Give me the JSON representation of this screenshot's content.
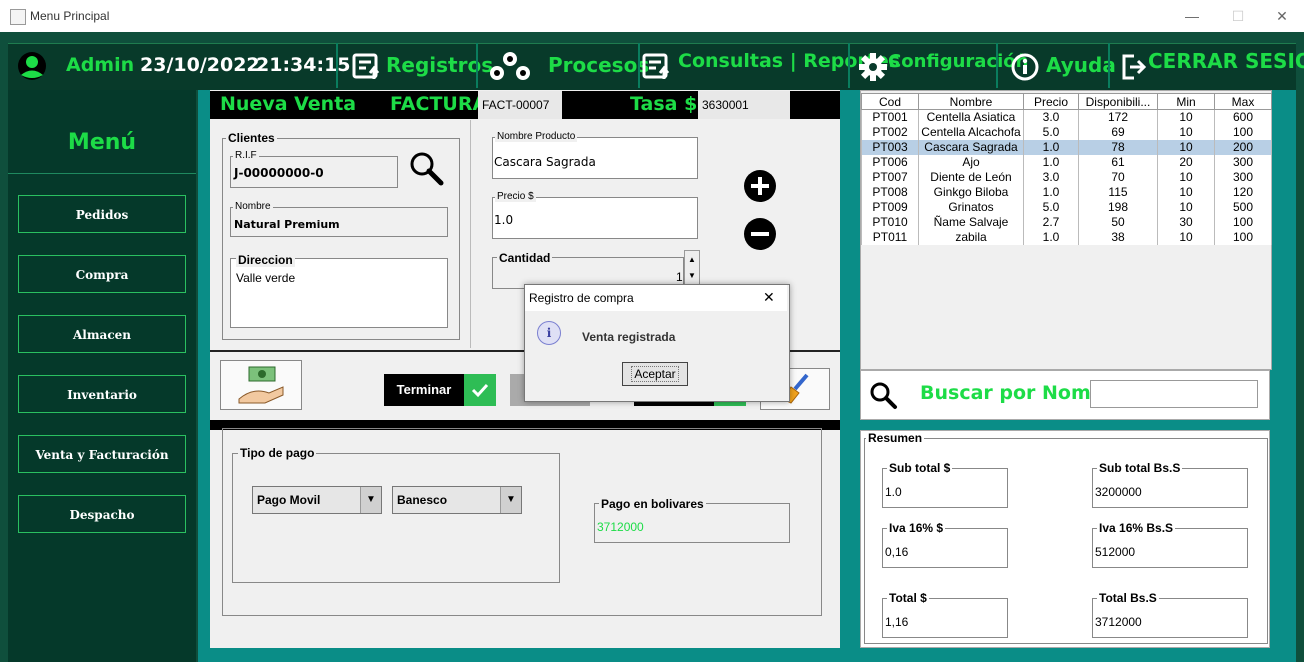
{
  "window": {
    "title": "Menu Principal",
    "minimize": "—",
    "maximize": "☐",
    "close": "✕"
  },
  "topbar": {
    "user": "Admin",
    "date": "23/10/2022",
    "time": "21:34:15",
    "menu": [
      "Registros",
      "Procesos",
      "Consultas | Reportes",
      "Configuracióṅ",
      "Ayuda",
      "CERRAR SESION"
    ]
  },
  "sidebar": {
    "title": "Menú",
    "items": [
      "Pedidos",
      "Compra",
      "Almacen",
      "Inventario",
      "Venta y Facturación",
      "Despacho"
    ]
  },
  "form": {
    "header": {
      "nueva_venta": "Nueva Venta",
      "factura": "FACTURA",
      "factura_value": "FACT-00007",
      "tasa": "Tasa $",
      "tasa_value": "3630001"
    },
    "clientes": {
      "label": "Clientes",
      "rif_label": "R.I.F",
      "rif_value": "J-00000000-0",
      "nombre_label": "Nombre",
      "nombre_value": "Natural Premium",
      "direccion_label": "Direccion",
      "direccion_value": "Valle verde"
    },
    "producto": {
      "nombre_label": "Nombre Producto",
      "nombre_value": "Cascara Sagrada",
      "precio_label": "Precio $",
      "precio_value": "1.0",
      "cantidad_label": "Cantidad",
      "cantidad_value": "1"
    },
    "actions": {
      "terminar": "Terminar"
    },
    "pago": {
      "tipo_label": "Tipo de pago",
      "tipo_value": "Pago Movil",
      "banco_value": "Banesco",
      "bolivares_label": "Pago en bolivares",
      "bolivares_value": "3712000"
    }
  },
  "products_table": {
    "columns": [
      "Cod",
      "Nombre",
      "Precio",
      "Disponibili...",
      "Min",
      "Max"
    ],
    "rows": [
      [
        "PT001",
        "Centella Asiatica",
        "3.0",
        "172",
        "10",
        "600"
      ],
      [
        "PT002",
        "Centella Alcachofa",
        "5.0",
        "69",
        "10",
        "100"
      ],
      [
        "PT003",
        "Cascara Sagrada",
        "1.0",
        "78",
        "10",
        "200"
      ],
      [
        "PT006",
        "Ajo",
        "1.0",
        "61",
        "20",
        "300"
      ],
      [
        "PT007",
        "Diente de León",
        "3.0",
        "70",
        "10",
        "300"
      ],
      [
        "PT008",
        "Ginkgo Biloba",
        "1.0",
        "115",
        "10",
        "120"
      ],
      [
        "PT009",
        "Grinatos",
        "5.0",
        "198",
        "10",
        "500"
      ],
      [
        "PT010",
        "Ñame Salvaje",
        "2.7",
        "50",
        "30",
        "100"
      ],
      [
        "PT011",
        "zabila",
        "1.0",
        "38",
        "10",
        "100"
      ]
    ],
    "selected_index": 2
  },
  "search": {
    "label": "Buscar por Nombre",
    "value": ""
  },
  "resumen": {
    "label": "Resumen",
    "subtotal_usd_label": "Sub total $",
    "subtotal_usd": "1.0",
    "subtotal_bs_label": "Sub total Bs.S",
    "subtotal_bs": "3200000",
    "iva_usd_label": "Iva 16% $",
    "iva_usd": "0,16",
    "iva_bs_label": "Iva 16% Bs.S",
    "iva_bs": "512000",
    "total_usd_label": "Total $",
    "total_usd": "1,16",
    "total_bs_label": "Total Bs.S",
    "total_bs": "3712000"
  },
  "dialog": {
    "title": "Registro de compra",
    "message": "Venta registrada",
    "ok": "Aceptar",
    "close": "✕",
    "info_glyph": "i"
  },
  "colors": {
    "accent_green": "#1ddc47",
    "dark_green": "#05392a",
    "teal": "#0a8d87"
  }
}
